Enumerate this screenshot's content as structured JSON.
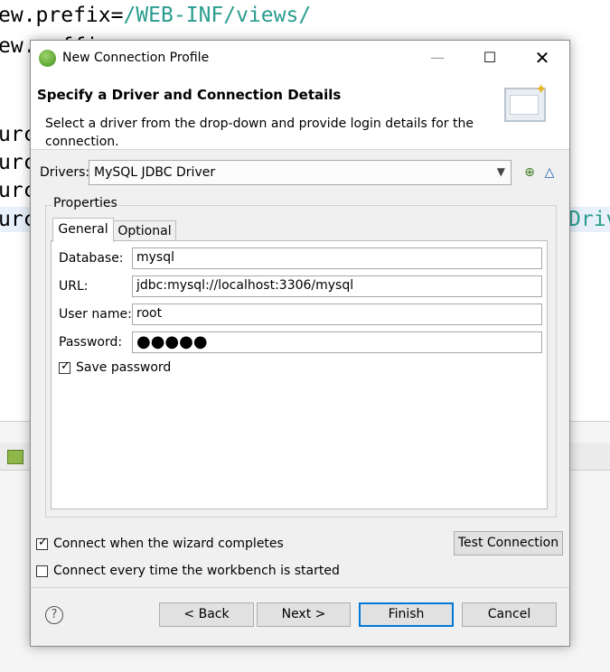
{
  "editor": {
    "code_lines": [
      {
        "prefix": "ew.prefix=",
        "value": "/WEB-INF/views/"
      },
      {
        "prefix": "ew.suffix=",
        "value": ""
      },
      {
        "prefix": "urc",
        "value": ""
      },
      {
        "prefix": "urc",
        "value": ""
      },
      {
        "prefix": "urc",
        "value": ""
      },
      {
        "prefix": "urc",
        "value": ""
      }
    ],
    "right_fragment": "Driv"
  },
  "dialog": {
    "title": "New Connection Profile",
    "icons": {
      "app": "eclipse-icon",
      "minimize": "minimize-icon",
      "maximize": "maximize-icon",
      "close": "close-icon"
    },
    "header": {
      "title": "Specify a Driver and Connection Details",
      "description": "Select a driver from the drop-down and provide login details for the connection."
    },
    "drivers": {
      "label": "Drivers:",
      "selected": "MySQL JDBC Driver"
    },
    "properties": {
      "label": "Properties",
      "tabs": [
        {
          "label": "General",
          "active": true
        },
        {
          "label": "Optional",
          "active": false
        }
      ],
      "fields": {
        "database": {
          "label": "Database:",
          "value": "mysql"
        },
        "url": {
          "label": "URL:",
          "value": "jdbc:mysql://localhost:3306/mysql"
        },
        "username": {
          "label": "User name:",
          "value": "root"
        },
        "password": {
          "label": "Password:",
          "value": "●●●●●"
        }
      },
      "save_password": {
        "label": "Save password",
        "checked": true
      }
    },
    "connect_when_complete": {
      "label": "Connect when the wizard completes",
      "checked": true
    },
    "connect_every_time": {
      "label": "Connect every time the workbench is started",
      "checked": false
    },
    "test_connection_label": "Test Connection",
    "buttons": {
      "back": "< Back",
      "next": "Next >",
      "finish": "Finish",
      "cancel": "Cancel"
    },
    "help_symbol": "?"
  },
  "colors": {
    "string": "#2a9d8f",
    "focus": "#0078d7"
  }
}
